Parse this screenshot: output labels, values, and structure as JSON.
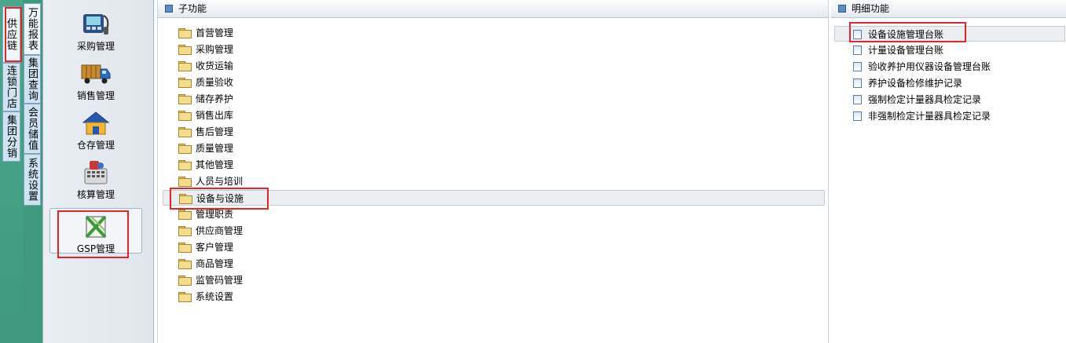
{
  "outer_tabs": [
    {
      "label": "供应链",
      "active": true
    },
    {
      "label": "连锁门店",
      "active": false
    },
    {
      "label": "集团分销",
      "active": false
    }
  ],
  "inner_tabs": [
    {
      "label": "万能报表",
      "active": true
    },
    {
      "label": "集团查询",
      "active": false
    },
    {
      "label": "会员储值",
      "active": false
    },
    {
      "label": "系统设置",
      "active": false
    }
  ],
  "modules": [
    {
      "label": "采购管理",
      "icon": "purchase-icon"
    },
    {
      "label": "销售管理",
      "icon": "truck-icon"
    },
    {
      "label": "仓存管理",
      "icon": "warehouse-icon"
    },
    {
      "label": "核算管理",
      "icon": "calculator-icon"
    },
    {
      "label": "GSP管理",
      "icon": "gsp-icon",
      "active": true
    }
  ],
  "sub_panel": {
    "title": "子功能",
    "items": [
      "首营管理",
      "采购管理",
      "收货运输",
      "质量验收",
      "储存养护",
      "销售出库",
      "售后管理",
      "质量管理",
      "其他管理",
      "人员与培训",
      "设备与设施",
      "管理职责",
      "供应商管理",
      "客户管理",
      "商品管理",
      "监管码管理",
      "系统设置"
    ],
    "selected_index": 10
  },
  "detail_panel": {
    "title": "明细功能",
    "items": [
      "设备设施管理台账",
      "计量设备管理台账",
      "验收养护用仪器设备管理台账",
      "养护设备检修维护记录",
      "强制检定计量器具检定记录",
      "非强制检定计量器具检定记录"
    ],
    "selected_index": 0
  },
  "colors": {
    "highlight": "#e2262b",
    "side_green": "#3f9a7d",
    "folder": "#f6dc8d"
  }
}
